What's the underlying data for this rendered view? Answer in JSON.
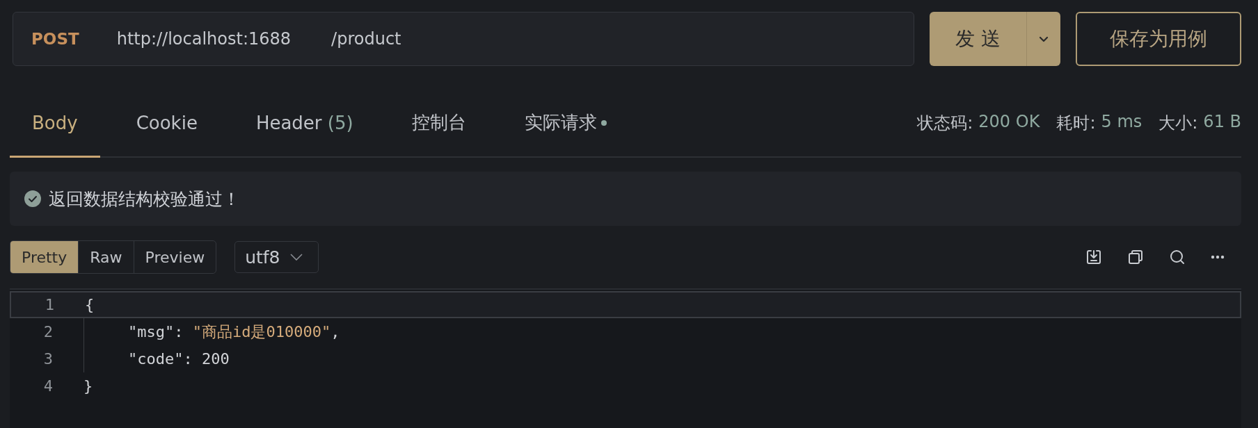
{
  "request": {
    "method": "POST",
    "base_url": "http://localhost:1688",
    "path": "/product"
  },
  "send_button": {
    "label": "发 送"
  },
  "save_button": {
    "label": "保存为用例"
  },
  "tabs": [
    {
      "label": "Body",
      "selected": true,
      "dot": false
    },
    {
      "label": "Cookie",
      "selected": false,
      "dot": false
    },
    {
      "label": "Header",
      "count": "(5)",
      "selected": false,
      "dot": false
    },
    {
      "label": "控制台",
      "selected": false,
      "dot": false
    },
    {
      "label": "实际请求",
      "selected": false,
      "dot": true
    }
  ],
  "status": [
    {
      "label": "状态码:",
      "value": "200 OK"
    },
    {
      "label": "耗时:",
      "value": "5 ms"
    },
    {
      "label": "大小:",
      "value": "61 B"
    }
  ],
  "validation": {
    "message": "返回数据结构校验通过！",
    "passed": true
  },
  "view_modes": [
    {
      "label": "Pretty",
      "selected": true
    },
    {
      "label": "Raw",
      "selected": false
    },
    {
      "label": "Preview",
      "selected": false
    }
  ],
  "encoding": "utf8",
  "code_lines": [
    {
      "number": "1",
      "active": true,
      "indent": false,
      "tokens": [
        {
          "kind": "punct",
          "text": "{"
        }
      ]
    },
    {
      "number": "2",
      "active": false,
      "indent": true,
      "tokens": [
        {
          "kind": "key",
          "text": "\"msg\""
        },
        {
          "kind": "punct",
          "text": ": "
        },
        {
          "kind": "string",
          "text": "\"商品id是010000\""
        },
        {
          "kind": "punct",
          "text": ","
        }
      ]
    },
    {
      "number": "3",
      "active": false,
      "indent": true,
      "tokens": [
        {
          "kind": "key",
          "text": "\"code\""
        },
        {
          "kind": "punct",
          "text": ": "
        },
        {
          "kind": "number",
          "text": "200"
        }
      ]
    },
    {
      "number": "4",
      "active": false,
      "indent": false,
      "tokens": [
        {
          "kind": "punct",
          "text": "}"
        }
      ]
    }
  ]
}
